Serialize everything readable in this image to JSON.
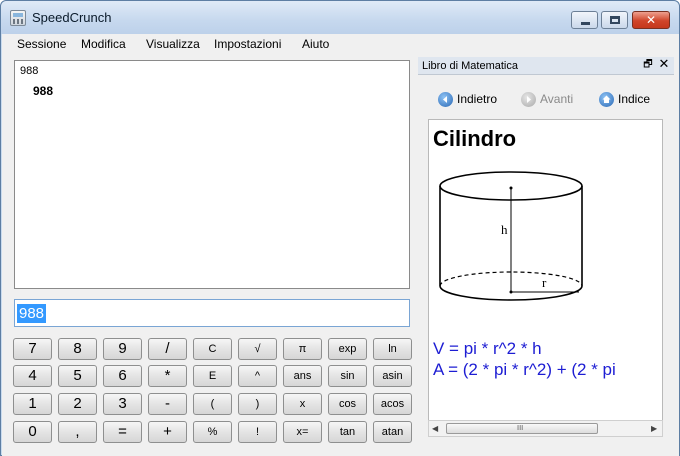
{
  "window": {
    "title": "SpeedCrunch",
    "close_glyph": "✕"
  },
  "menu": [
    "Sessione",
    "Modifica",
    "Visualizza",
    "Impostazioni",
    "Aiuto"
  ],
  "display": {
    "expression": "988",
    "result": "988"
  },
  "input": {
    "value": "988"
  },
  "keypad": {
    "rows": [
      [
        "7",
        "8",
        "9",
        "/",
        "C",
        "√",
        "π",
        "exp",
        "ln"
      ],
      [
        "4",
        "5",
        "6",
        "*",
        "E",
        "^",
        "ans",
        "sin",
        "asin"
      ],
      [
        "1",
        "2",
        "3",
        "-",
        "(",
        ")",
        "x",
        "cos",
        "acos"
      ],
      [
        "0",
        ",",
        "=",
        "+",
        "%",
        "!",
        "x=",
        "tan",
        "atan"
      ]
    ]
  },
  "book_panel": {
    "title": "Libro di Matematica",
    "float_glyph": "🗗",
    "close_glyph": "✕",
    "nav": {
      "back": "Indietro",
      "forward": "Avanti",
      "index": "Indice"
    },
    "heading": "Cilindro",
    "diagram": {
      "height_label": "h",
      "radius_label": "r"
    },
    "formula_volume": "V = pi * r^2 * h",
    "formula_area": "A = (2 * pi * r^2) + (2 * pi",
    "scroll_grip": "III"
  },
  "colors": {
    "formula": "#1d1dd3",
    "selection": "#3399ff",
    "close_button": "#d0452a"
  },
  "icons": [
    "app-icon",
    "minimize-icon",
    "maximize-icon",
    "close-icon",
    "back-arrow-icon",
    "forward-arrow-icon",
    "home-icon"
  ]
}
